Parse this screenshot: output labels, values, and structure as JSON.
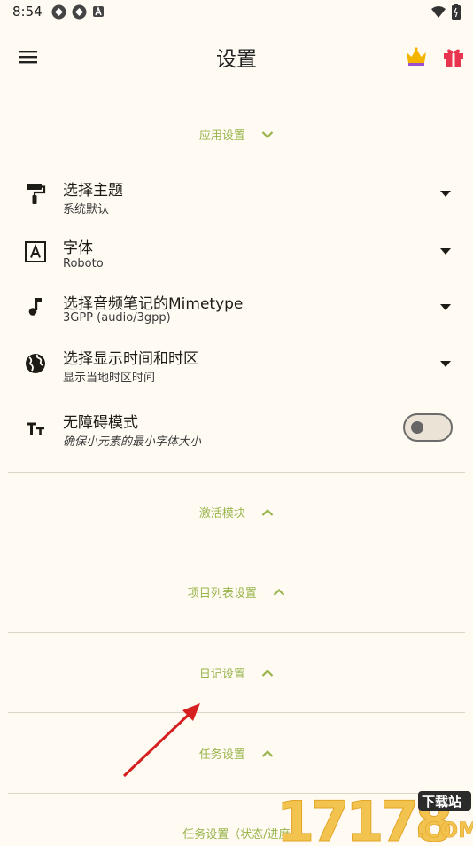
{
  "status_bar": {
    "time": "8:54"
  },
  "app_bar": {
    "title": "设置",
    "icons": [
      "menu-icon",
      "crown-icon",
      "gift-icon"
    ]
  },
  "sections": {
    "app_settings": "应用设置",
    "activate_modules": "激活模块",
    "project_list_settings": "项目列表设置",
    "diary_settings": "日记设置",
    "task_settings": "任务设置",
    "task_status_settings": "任务设置（状态/进度"
  },
  "settings": {
    "theme": {
      "title": "选择主题",
      "subtitle": "系统默认",
      "icon": "paint-roller-icon"
    },
    "font": {
      "title": "字体",
      "subtitle": "Roboto",
      "icon": "font-icon"
    },
    "mimetype": {
      "title": "选择音频笔记的Mimetype",
      "subtitle": "3GPP (audio/3gpp)",
      "icon": "music-note-icon"
    },
    "timezone": {
      "title": "选择显示时间和时区",
      "subtitle": "显示当地时区时间",
      "icon": "globe-icon"
    },
    "accessibility": {
      "title": "无障碍模式",
      "subtitle": "确保小元素的最小字体大小",
      "icon": "text-size-icon",
      "enabled": false
    }
  },
  "colors": {
    "background": "#fffbf3",
    "accent": "#98b44a",
    "text": "#1d1b16"
  },
  "watermark": {
    "numbers": "17178",
    "badge": "下载站",
    "suffix": ".COM"
  }
}
